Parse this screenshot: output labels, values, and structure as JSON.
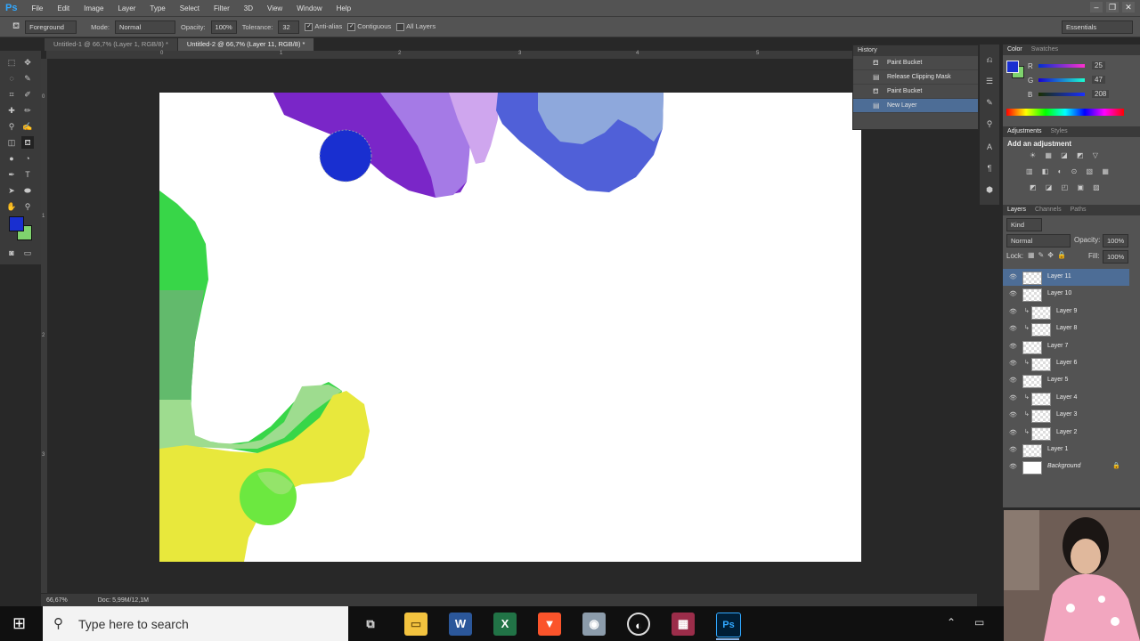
{
  "app": {
    "logo": "Ps"
  },
  "menu": [
    "File",
    "Edit",
    "Image",
    "Layer",
    "Type",
    "Select",
    "Filter",
    "3D",
    "View",
    "Window",
    "Help"
  ],
  "options_bar": {
    "fill_source": "Foreground",
    "mode_label": "Mode:",
    "mode_value": "Normal",
    "opacity_label": "Opacity:",
    "opacity_value": "100%",
    "tolerance_label": "Tolerance:",
    "tolerance_value": "32",
    "antialias_label": "Anti-alias",
    "contiguous_label": "Contiguous",
    "all_layers_label": "All Layers",
    "workspace": "Essentials"
  },
  "tabs": [
    {
      "label": "Untitled-1 @ 66,7% (Layer 1, RGB/8) *"
    },
    {
      "label": "Untitled-2 @ 66,7% (Layer 11, RGB/8) *"
    }
  ],
  "ruler_top": [
    "0",
    "1",
    "2",
    "3",
    "4",
    "5"
  ],
  "ruler_left": [
    "0",
    "1",
    "2",
    "3"
  ],
  "status": {
    "zoom": "66,67%",
    "doc": "Doc: 5,99M/12,1M"
  },
  "history": {
    "title": "History",
    "items": [
      {
        "label": "Paint Bucket",
        "icon": "paint-bucket-icon"
      },
      {
        "label": "Release Clipping Mask",
        "icon": "layer-icon"
      },
      {
        "label": "Paint Bucket",
        "icon": "paint-bucket-icon"
      },
      {
        "label": "New Layer",
        "icon": "layer-icon"
      }
    ]
  },
  "color_panel": {
    "tabs": [
      "Color",
      "Swatches"
    ],
    "r_label": "R",
    "g_label": "G",
    "b_label": "B",
    "r": "25",
    "g": "47",
    "b": "208",
    "foreground": "#192fd0",
    "background_swatch": "#7fd36e"
  },
  "adjustments": {
    "tabs": [
      "Adjustments",
      "Styles"
    ],
    "heading": "Add an adjustment"
  },
  "layers_panel": {
    "tabs": [
      "Layers",
      "Channels",
      "Paths"
    ],
    "kind": "Kind",
    "blend": "Normal",
    "opacity_label": "Opacity:",
    "opacity": "100%",
    "lock_label": "Lock:",
    "fill_label": "Fill:",
    "fill": "100%",
    "layers": [
      {
        "name": "Layer 11",
        "selected": true,
        "clipped": false
      },
      {
        "name": "Layer 10",
        "selected": false,
        "clipped": false
      },
      {
        "name": "Layer 9",
        "selected": false,
        "clipped": true
      },
      {
        "name": "Layer 8",
        "selected": false,
        "clipped": true
      },
      {
        "name": "Layer 7",
        "selected": false,
        "clipped": false
      },
      {
        "name": "Layer 6",
        "selected": false,
        "clipped": true
      },
      {
        "name": "Layer 5",
        "selected": false,
        "clipped": false
      },
      {
        "name": "Layer 4",
        "selected": false,
        "clipped": true
      },
      {
        "name": "Layer 3",
        "selected": false,
        "clipped": true
      },
      {
        "name": "Layer 2",
        "selected": false,
        "clipped": true
      },
      {
        "name": "Layer 1",
        "selected": false,
        "clipped": false
      },
      {
        "name": "Background",
        "selected": false,
        "clipped": false,
        "locked": true
      }
    ]
  },
  "taskbar": {
    "search_placeholder": "Type here to search",
    "apps": [
      "task-view",
      "file-explorer",
      "word",
      "excel",
      "brave",
      "app",
      "obs",
      "winrar",
      "photoshop"
    ]
  }
}
